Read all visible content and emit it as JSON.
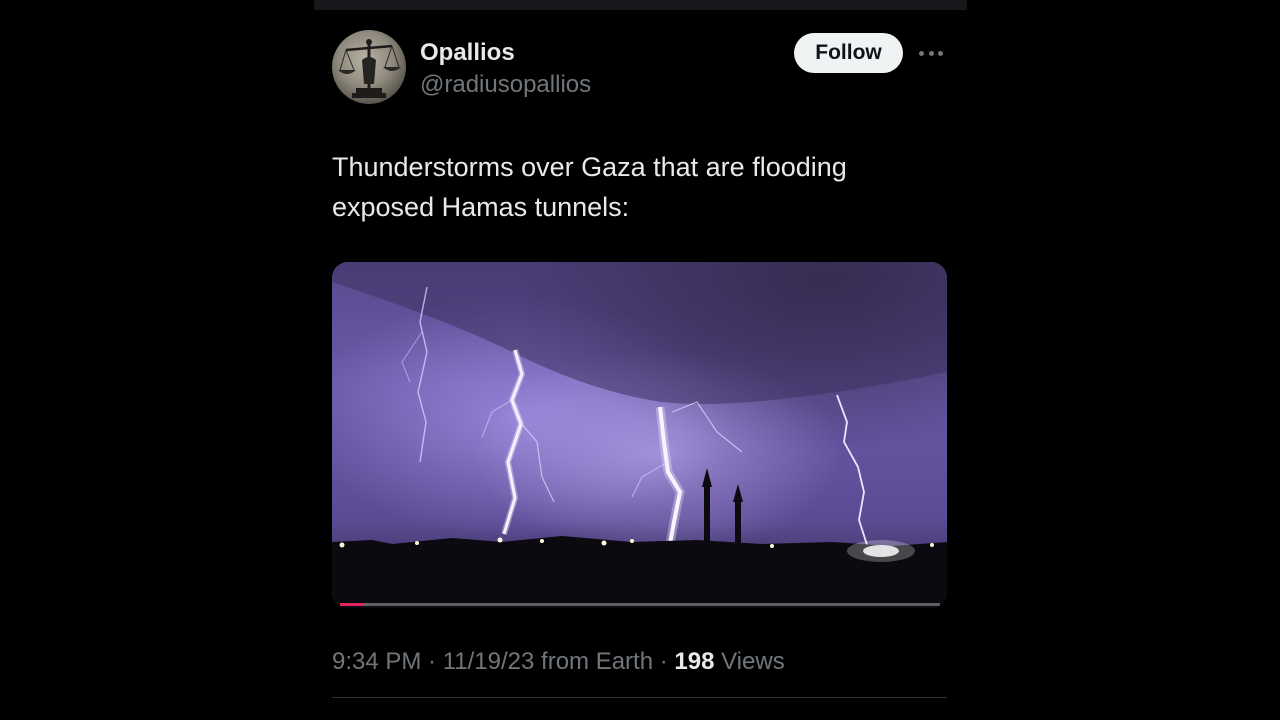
{
  "author": {
    "name": "Opallios",
    "handle": "@radiusopallios"
  },
  "follow_label": "Follow",
  "tweet": {
    "text": "Thunderstorms over Gaza that are flooding\nexposed Hamas tunnels:"
  },
  "media": {
    "type": "video",
    "progress": 0.04
  },
  "meta": {
    "time": "9:34 PM",
    "date": "11/19/23",
    "source": "from Earth",
    "views_count": "198",
    "views_label": "Views"
  },
  "colors": {
    "background": "#000000",
    "text_primary": "#e7e9ea",
    "text_secondary": "#71767b",
    "follow_bg": "#eff3f4",
    "progress": "#e0245e"
  },
  "icons": {
    "more": "more-horizontal-icon",
    "avatar": "scales-of-justice"
  }
}
